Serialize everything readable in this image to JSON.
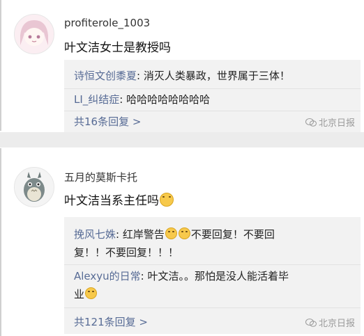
{
  "comments": [
    {
      "username": "profiterole_1003",
      "text": "叶文洁女士是教授吗",
      "avatar_icon": "girl-avatar",
      "replies": [
        {
          "user": "诗恒文创黍夏",
          "sep": ": ",
          "text": "消灭人类暴政，世界属于三体！"
        },
        {
          "user": "LI_纠结症",
          "sep": ": ",
          "text": "哈哈哈哈哈哈哈哈"
        }
      ],
      "more": "共16条回复 >",
      "watermark": "北京日报"
    },
    {
      "username": "五月的莫斯卡托",
      "text": "叶文洁当系主任吗",
      "avatar_icon": "totoro-avatar",
      "replies": [
        {
          "user": "挽风七姝",
          "sep": ": ",
          "text_a": "红岸警告",
          "text_b": "不要回复！不要回",
          "text_c": "复！！不要回复！！！"
        },
        {
          "user": "Alexyu的日常",
          "sep": ": ",
          "text_a": "叶文洁。。那怕是没人能活着毕",
          "text_b": "业"
        }
      ],
      "more": "共121条回复 >",
      "watermark": "北京日报"
    }
  ],
  "colors": {
    "link": "#576b95",
    "reply_bg": "#f2f2f2",
    "divider": "#ececec"
  }
}
